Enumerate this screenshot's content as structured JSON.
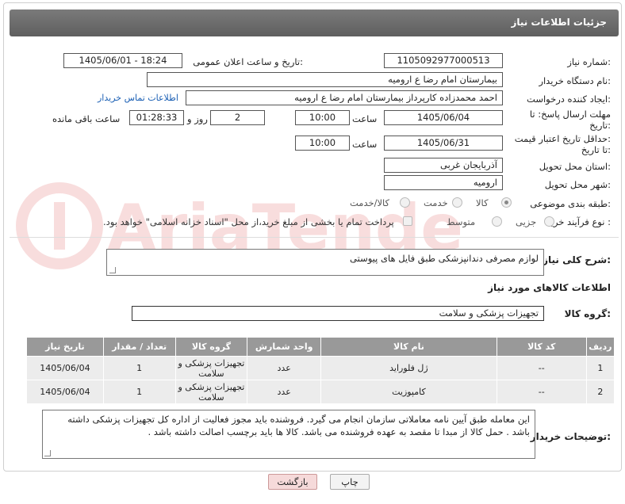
{
  "header": {
    "title": "جزئیات اطلاعات نیاز"
  },
  "fields": {
    "need_number_label": "شماره نیاز:",
    "need_number": "1105092977000513",
    "announce_label": "تاریخ و ساعت اعلان عمومی:",
    "announce_value": "1405/06/01 - 18:24",
    "buyer_label": "نام دستگاه خریدار:",
    "buyer_value": "بیمارستان امام رضا  ع  ارومیه",
    "creator_label": "ایجاد کننده درخواست:",
    "creator_value": "احمد محمدزاده کارپرداز بیمارستان امام رضا  ع  ارومیه",
    "contact_link": "اطلاعات تماس خریدار",
    "reply_label_1": "مهلت ارسال پاسخ: تا",
    "reply_label_2": "تاریخ:",
    "reply_date": "1405/06/04",
    "time_label": "ساعت",
    "reply_time": "10:00",
    "days_value": "2",
    "days_label": "روز و",
    "remaining_time": "01:28:33",
    "remaining_label": "ساعت باقی مانده",
    "price_label_1": "حداقل تاریخ اعتبار قیمت:",
    "price_label_2": "تا تاریخ:",
    "price_date": "1405/06/31",
    "price_time": "10:00",
    "province_label": "استان محل تحویل:",
    "province_value": "آذربایجان غربی",
    "city_label": "شهر محل تحویل:",
    "city_value": "ارومیه",
    "category_label": "طبقه بندی موضوعی:",
    "category_options": [
      "کالا",
      "خدمت",
      "کالا/خدمت"
    ],
    "process_label": "نوع فرآیند خرید :",
    "process_options": [
      "جزیی",
      "متوسط"
    ],
    "payment_note": "پرداخت تمام یا بخشی از مبلغ خرید،از محل \"اسناد خزانه اسلامی\" خواهد بود."
  },
  "need_desc": {
    "label": "شرح کلی نیاز:",
    "value": "لوازم مصرفی دندانپزشکی طبق فایل های پیوستی"
  },
  "goods_info": {
    "title": "اطلاعات کالاهای مورد نیاز",
    "group_label": "گروه کالا:",
    "group_value": "تجهیزات پزشکی و سلامت"
  },
  "table": {
    "headers": [
      "ردیف",
      "کد کالا",
      "نام کالا",
      "واحد شمارش",
      "گروه کالا",
      "تعداد / مقدار",
      "تاریخ نیاز"
    ],
    "rows": [
      [
        "1",
        "--",
        "ژل فلوراید",
        "عدد",
        "تجهیزات پزشکی و سلامت",
        "1",
        "1405/06/04"
      ],
      [
        "2",
        "--",
        "کامپوزیت",
        "عدد",
        "تجهیزات پزشکی و سلامت",
        "1",
        "1405/06/04"
      ]
    ]
  },
  "buyer_notes": {
    "label": "توضیحات خریدار:",
    "value": "این معامله طبق آیین نامه معاملاتی سازمان انجام می گیرد. فروشنده باید مجوز فعالیت از اداره کل تجهیزات پزشکی داشته باشد . حمل کالا از مبدا تا مقصد به عهده فروشنده می باشد. کالا ها باید برچسب اصالت داشته باشد ."
  },
  "buttons": {
    "print": "چاپ",
    "back": "بازگشت"
  },
  "watermark": "AriaTender.net",
  "colors": {
    "header_bg": "#6b6b6b",
    "table_header_bg": "#999999",
    "link": "#1a5fb4",
    "back_button_bg": "#f6dada"
  }
}
